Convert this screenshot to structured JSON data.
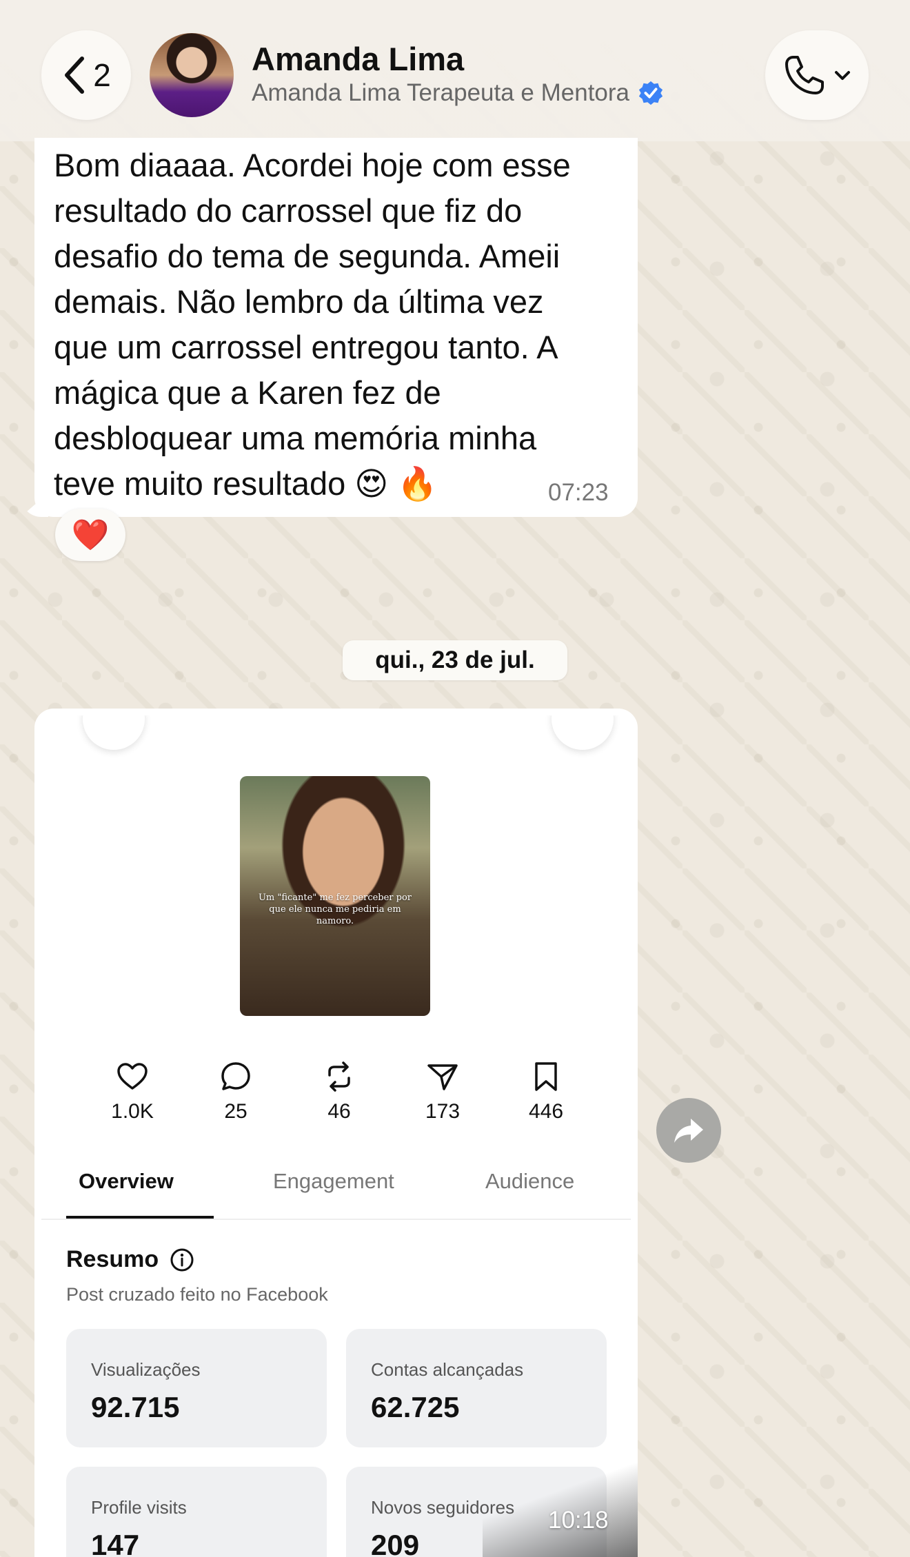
{
  "header": {
    "back_count": "2",
    "contact_name": "Amanda Lima",
    "contact_subtitle": "Amanda Lima Terapeuta e Mentora"
  },
  "messages": {
    "text_message": {
      "body": "Bom diaaaa. Acordei hoje com esse\nresultado do carrossel que fiz do\ndesafio do tema de segunda. Ameii\ndemais. Não lembro da última vez\nque um carrossel entregou tanto. A\nmágica que a Karen fez de\ndesbloquear uma memória minha\nteve muito resultado 😍 🔥",
      "time": "07:23",
      "reaction": "❤️"
    },
    "date_separator": "qui., 23 de jul.",
    "image_message": {
      "time": "10:18"
    }
  },
  "screenshot": {
    "post_caption": "Um \"ficante\" me fez perceber por que ele nunca me pediria em namoro.",
    "stats": [
      {
        "icon": "heart-icon",
        "value": "1.0K"
      },
      {
        "icon": "comment-icon",
        "value": "25"
      },
      {
        "icon": "repost-icon",
        "value": "46"
      },
      {
        "icon": "send-icon",
        "value": "173"
      },
      {
        "icon": "bookmark-icon",
        "value": "446"
      }
    ],
    "tabs": [
      "Overview",
      "Engagement",
      "Audience"
    ],
    "summary_title": "Resumo",
    "summary_subtitle": "Post cruzado feito no Facebook",
    "metrics": [
      {
        "label": "Visualizações",
        "value": "92.715"
      },
      {
        "label": "Contas alcançadas",
        "value": "62.725"
      },
      {
        "label": "Profile visits",
        "value": "147"
      },
      {
        "label": "Novos seguidores",
        "value": "209"
      }
    ]
  },
  "colors": {
    "chat_background": "#efe9df",
    "bubble": "#ffffff",
    "verified": "#3b82f6"
  }
}
